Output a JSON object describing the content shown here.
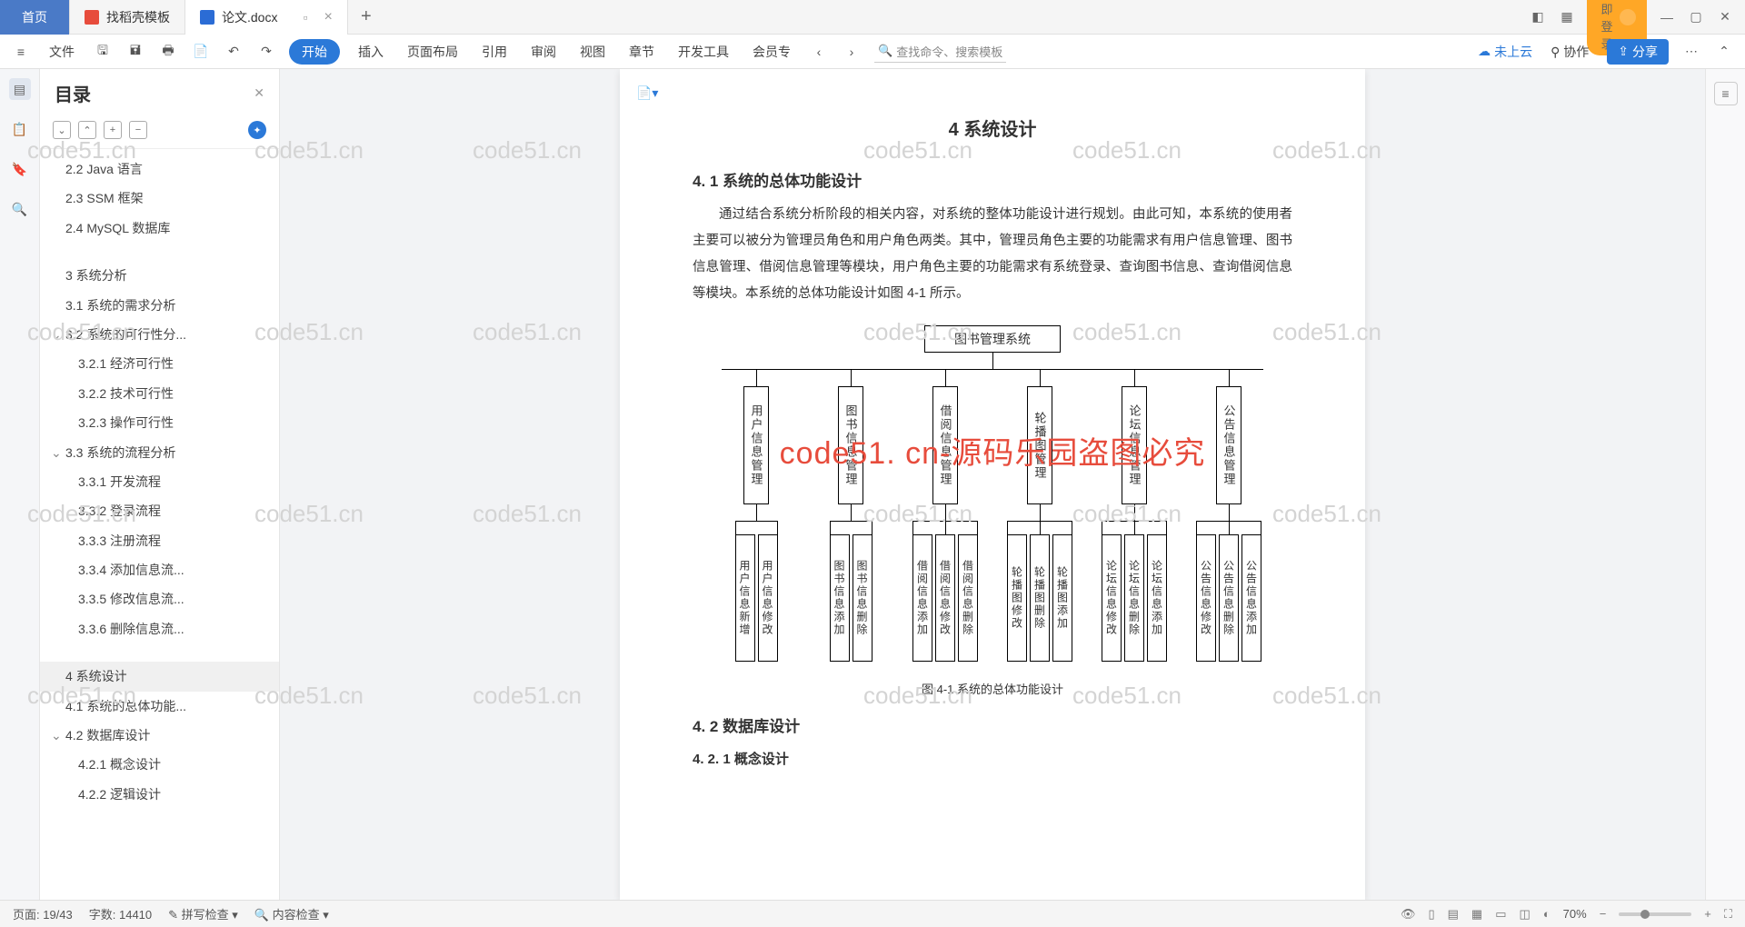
{
  "tabs": {
    "home": "首页",
    "template": "找稻壳模板",
    "doc": "论文.docx"
  },
  "ribbon": {
    "file": "文件",
    "start": "开始",
    "insert": "插入",
    "layout": "页面布局",
    "ref": "引用",
    "review": "审阅",
    "view": "视图",
    "chapter": "章节",
    "dev": "开发工具",
    "member": "会员专",
    "search": "查找命令、搜索模板",
    "cloud": "未上云",
    "collab": "协作",
    "share": "分享"
  },
  "login": "立即登录",
  "toc": {
    "title": "目录",
    "items": [
      {
        "t": "2.2 Java 语言",
        "l": 1
      },
      {
        "t": "2.3 SSM 框架",
        "l": 1
      },
      {
        "t": "2.4 MySQL 数据库",
        "l": 1
      },
      {
        "t": "3 系统分析",
        "l": 1,
        "gap": 1
      },
      {
        "t": "3.1 系统的需求分析",
        "l": 1
      },
      {
        "t": "3.2 系统的可行性分...",
        "l": 1,
        "c": 1
      },
      {
        "t": "3.2.1 经济可行性",
        "l": 2
      },
      {
        "t": "3.2.2 技术可行性",
        "l": 2
      },
      {
        "t": "3.2.3 操作可行性",
        "l": 2
      },
      {
        "t": "3.3 系统的流程分析",
        "l": 1,
        "c": 1
      },
      {
        "t": "3.3.1 开发流程",
        "l": 2
      },
      {
        "t": "3.3.2 登录流程",
        "l": 2
      },
      {
        "t": "3.3.3 注册流程",
        "l": 2
      },
      {
        "t": "3.3.4 添加信息流...",
        "l": 2
      },
      {
        "t": "3.3.5 修改信息流...",
        "l": 2
      },
      {
        "t": "3.3.6 删除信息流...",
        "l": 2
      },
      {
        "t": "4 系统设计",
        "l": 1,
        "sel": 1,
        "gap": 1
      },
      {
        "t": "4.1 系统的总体功能...",
        "l": 1
      },
      {
        "t": "4.2 数据库设计",
        "l": 1,
        "c": 1
      },
      {
        "t": "4.2.1 概念设计",
        "l": 2
      },
      {
        "t": "4.2.2 逻辑设计",
        "l": 2
      }
    ]
  },
  "doc": {
    "h1": "4 系统设计",
    "h2a": "4. 1 系统的总体功能设计",
    "p1": "通过结合系统分析阶段的相关内容，对系统的整体功能设计进行规划。由此可知，本系统的使用者主要可以被分为管理员角色和用户角色两类。其中，管理员角色主要的功能需求有用户信息管理、图书信息管理、借阅信息管理等模块，用户角色主要的功能需求有系统登录、查询图书信息、查询借阅信息等模块。本系统的总体功能设计如图 4-1 所示。",
    "root": "图书管理系统",
    "mods": [
      "用户信息管理",
      "图书信息管理",
      "借阅信息管理",
      "轮播图管理",
      "论坛信息管理",
      "公告信息管理"
    ],
    "subs": [
      [
        "用户信息新增",
        "用户信息修改"
      ],
      [
        "图书信息添加",
        "图书信息删除"
      ],
      [
        "借阅信息添加",
        "借阅信息修改",
        "借阅信息删除"
      ],
      [
        "轮播图修改",
        "轮播图删除",
        "轮播图添加"
      ],
      [
        "论坛信息修改",
        "论坛信息删除",
        "论坛信息添加"
      ],
      [
        "公告信息修改",
        "公告信息删除",
        "公告信息添加"
      ]
    ],
    "caption": "图 4-1 系统的总体功能设计",
    "h2b": "4. 2 数据库设计",
    "h3a": "4. 2. 1 概念设计"
  },
  "watermark_main": "code51. cn-源码乐园盗图必究",
  "watermark_bg": "code51.cn",
  "status": {
    "page": "页面: 19/43",
    "words": "字数: 14410",
    "spell": "拼写检查",
    "content": "内容检查",
    "zoom": "70%"
  }
}
